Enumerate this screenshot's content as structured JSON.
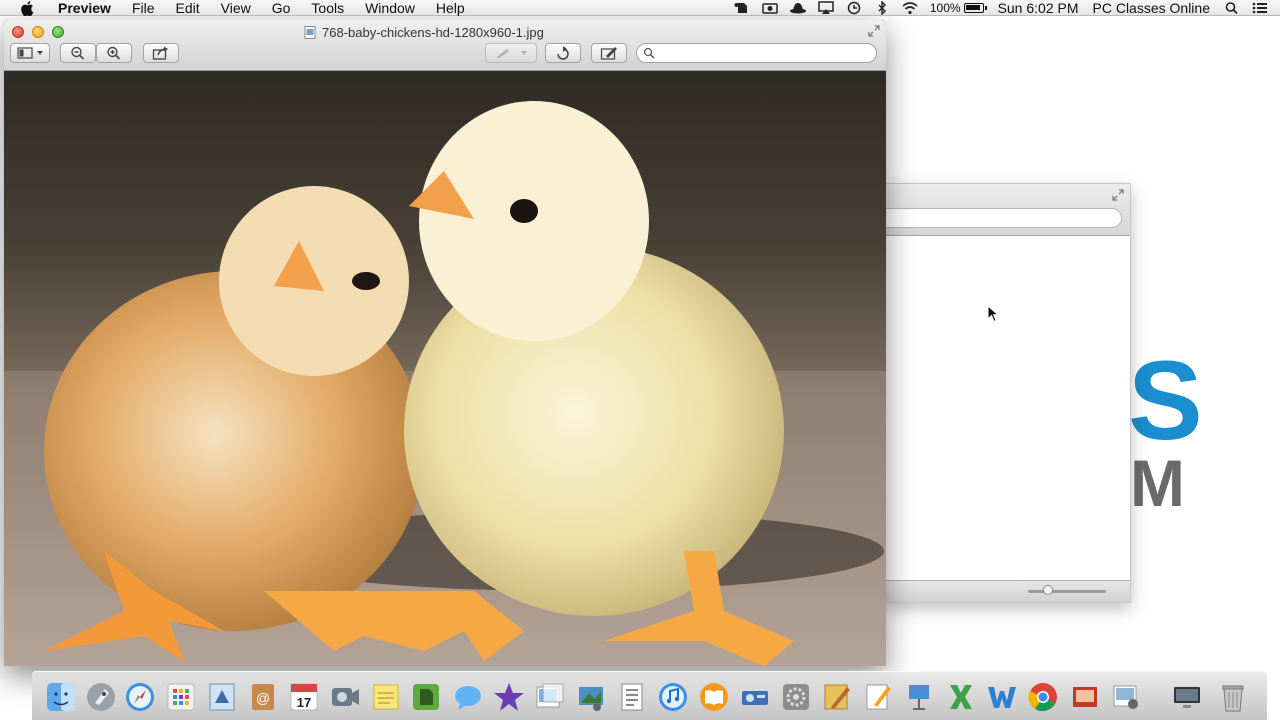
{
  "menubar": {
    "apple_icon": "apple-icon",
    "app_name": "Preview",
    "items": [
      "File",
      "Edit",
      "View",
      "Go",
      "Tools",
      "Window",
      "Help"
    ],
    "status_icons": [
      "evernote-icon",
      "screen-capture-icon",
      "spy-hat-icon",
      "airplay-icon",
      "time-machine-icon",
      "bluetooth-icon",
      "wifi-icon"
    ],
    "battery_percent": "100%",
    "clock": "Sun 6:02 PM",
    "user": "PC Classes Online"
  },
  "preview_window": {
    "title": "768-baby-chickens-hd-1280x960-1.jpg",
    "search": {
      "value": "",
      "placeholder": ""
    }
  },
  "background_brand": {
    "letter1": "S",
    "letter2": "M",
    "accent_color": "#1b8ecf"
  },
  "dock": {
    "icons": [
      "finder",
      "launchpad",
      "safari",
      "dashboard",
      "mail-stamp",
      "address-book",
      "calendar",
      "facetime",
      "stickies",
      "evernote",
      "messages",
      "imovie",
      "preview",
      "iphoto",
      "textedit",
      "itunes",
      "ibooks",
      "keynote",
      "system-preferences",
      "script-editor",
      "pages",
      "keynote-stand",
      "excel",
      "word",
      "chrome",
      "photo-booth",
      "image-capture",
      "monitor",
      "trash"
    ],
    "calendar_day": "17"
  },
  "colors": {
    "accent": "#1b8ecf",
    "close": "#e33e2f",
    "minimize": "#e3a91d",
    "zoom": "#3ea92b"
  }
}
